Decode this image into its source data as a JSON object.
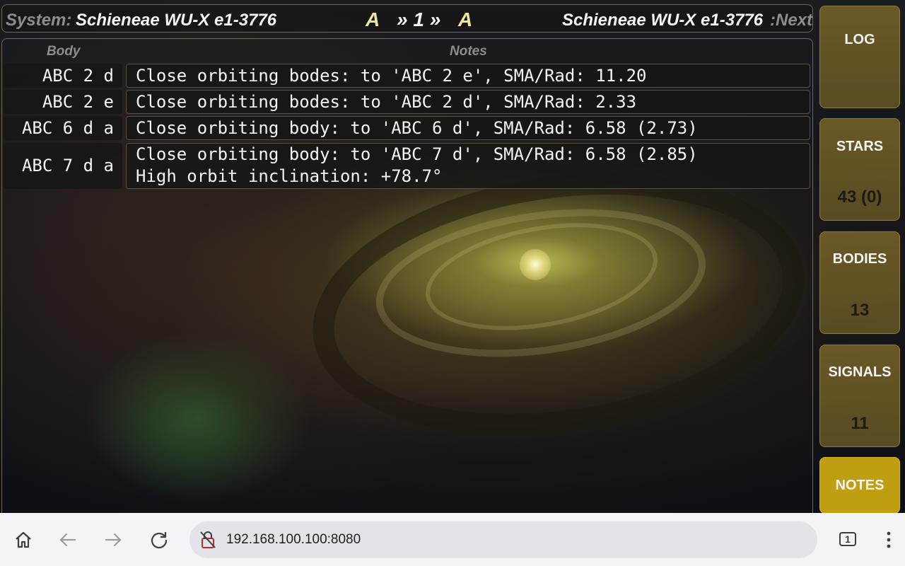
{
  "header": {
    "system_label": "System:",
    "system_name": "Schieneae WU-X e1-3776",
    "nav_start": "A",
    "nav_middle": "» 1 »",
    "nav_end": "A",
    "next_system_name": "Schieneae WU-X e1-3776",
    "next_label": ":Next"
  },
  "table": {
    "columns": [
      "Body",
      "Notes"
    ],
    "rows": [
      {
        "body": "ABC 2 d",
        "notes": "Close orbiting bodes: to 'ABC 2 e', SMA/Rad: 11.20"
      },
      {
        "body": "ABC 2 e",
        "notes": "Close orbiting bodes: to 'ABC 2 d', SMA/Rad: 2.33"
      },
      {
        "body": "ABC 6 d a",
        "notes": "Close orbiting body: to 'ABC 6 d', SMA/Rad: 6.58 (2.73)"
      },
      {
        "body": "ABC 7 d a",
        "notes": "Close orbiting body: to 'ABC 7 d', SMA/Rad: 6.58 (2.85)\nHigh orbit inclination: +78.7°"
      }
    ]
  },
  "sidebar": {
    "buttons": [
      {
        "label": "LOG",
        "count": ""
      },
      {
        "label": "STARS",
        "count": "43 (0)"
      },
      {
        "label": "BODIES",
        "count": "13"
      },
      {
        "label": "SIGNALS",
        "count": "11"
      },
      {
        "label": "NOTES",
        "count": ""
      }
    ],
    "active": "NOTES",
    "accent_color": "#bf9e12"
  },
  "browser": {
    "url": "192.168.100.100:8080",
    "tab_count": "1",
    "icons": [
      "home-icon",
      "back-arrow-icon",
      "forward-arrow-icon",
      "reload-icon",
      "insecure-lock-icon",
      "tabs-icon",
      "more-vert-icon"
    ]
  }
}
